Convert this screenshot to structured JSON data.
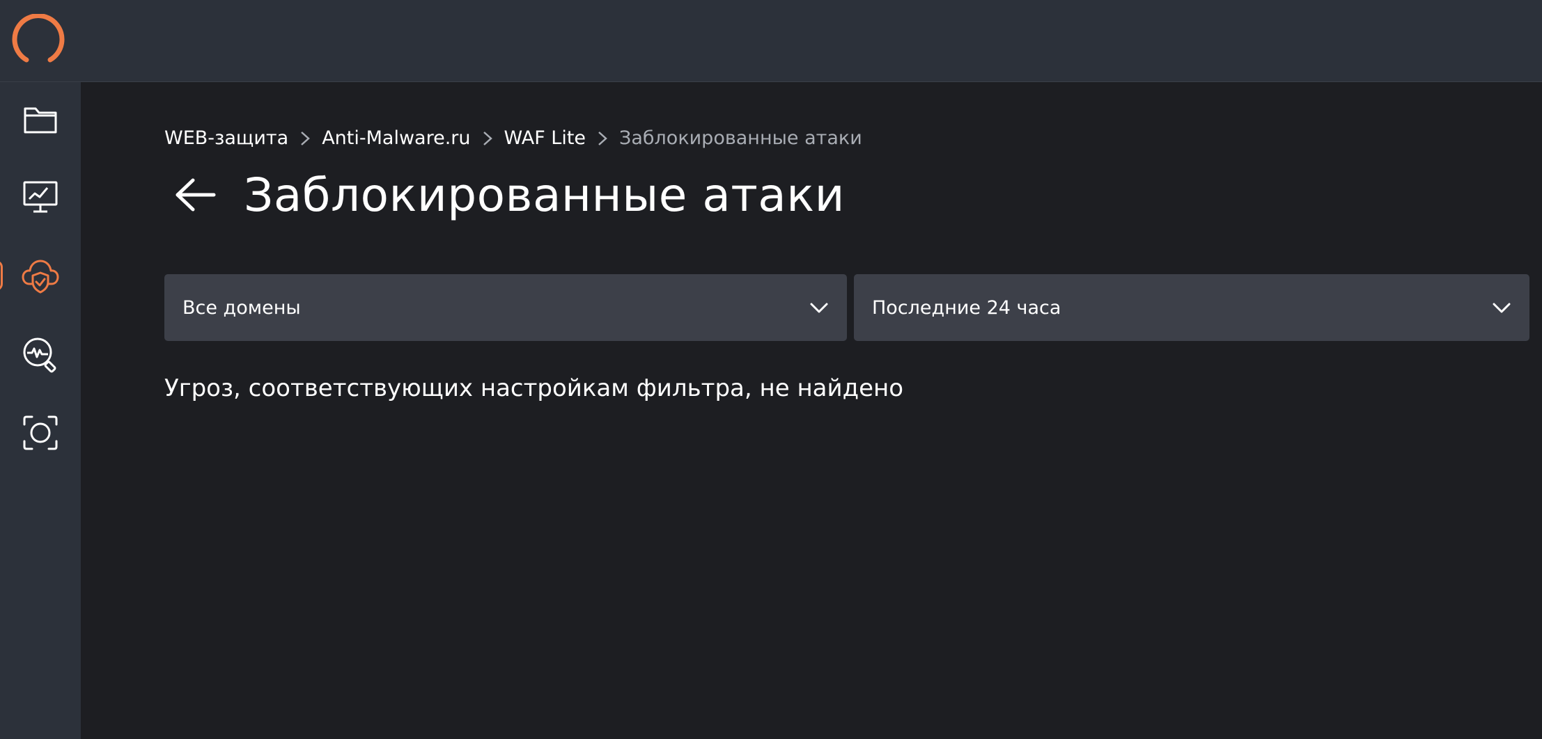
{
  "colors": {
    "accent": "#ef7b45",
    "topbar_bg": "#2c313a",
    "main_bg": "#1d1e22",
    "select_bg": "#3d4049",
    "muted_text": "#a9adb4"
  },
  "topbar": {
    "logo_icon": "ring-logo-icon"
  },
  "sidebar": {
    "items": [
      {
        "icon": "folder-icon",
        "active": false
      },
      {
        "icon": "monitor-chart-icon",
        "active": false
      },
      {
        "icon": "cloud-shield-icon",
        "active": true
      },
      {
        "icon": "search-pulse-icon",
        "active": false
      },
      {
        "icon": "scan-circle-icon",
        "active": false
      }
    ]
  },
  "breadcrumb": {
    "items": [
      {
        "label": "WEB-защита"
      },
      {
        "label": "Anti-Malware.ru"
      },
      {
        "label": "WAF Lite"
      },
      {
        "label": "Заблокированные атаки"
      }
    ],
    "separator_icon": "chevron-right-icon"
  },
  "page": {
    "back_icon": "arrow-left-icon",
    "title": "Заблокированные атаки"
  },
  "filters": {
    "domains": {
      "value": "Все домены",
      "icon": "chevron-down-icon"
    },
    "period": {
      "value": "Последние 24 часа",
      "icon": "chevron-down-icon"
    }
  },
  "empty_state": {
    "message": "Угроз, соответствующих настройкам фильтра, не найдено"
  }
}
